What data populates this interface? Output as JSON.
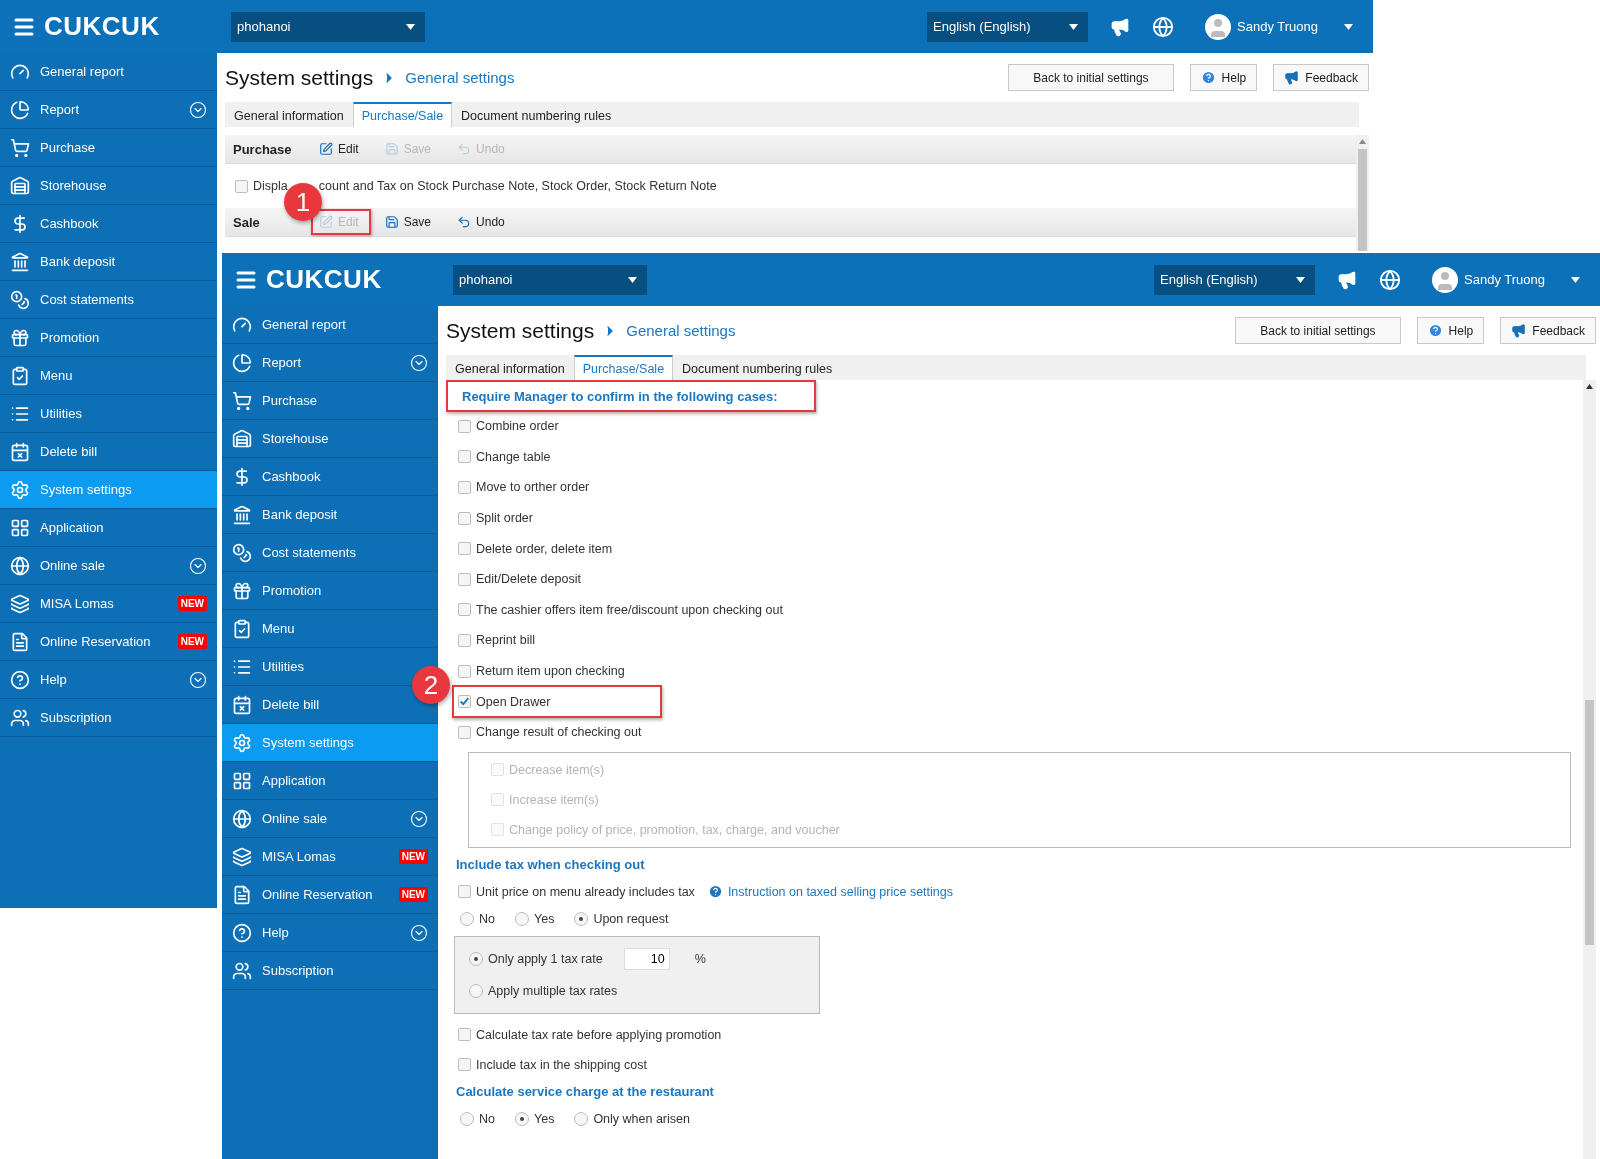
{
  "back_window": {
    "header": {
      "logo": "CUKCUK",
      "branch": "phohanoi",
      "language": "English (English)",
      "user": "Sandy Truong"
    },
    "sidebar": [
      {
        "label": "General report",
        "selected": false
      },
      {
        "label": "Report",
        "selected": false,
        "expandable": true
      },
      {
        "label": "Purchase",
        "selected": false
      },
      {
        "label": "Storehouse",
        "selected": false
      },
      {
        "label": "Cashbook",
        "selected": false
      },
      {
        "label": "Bank deposit",
        "selected": false
      },
      {
        "label": "Cost statements",
        "selected": false
      },
      {
        "label": "Promotion",
        "selected": false
      },
      {
        "label": "Menu",
        "selected": false
      },
      {
        "label": "Utilities",
        "selected": false
      },
      {
        "label": "Delete bill",
        "selected": false
      },
      {
        "label": "System settings",
        "selected": true
      },
      {
        "label": "Application",
        "selected": false
      },
      {
        "label": "Online sale",
        "selected": false,
        "expandable": true
      },
      {
        "label": "MISA Lomas",
        "selected": false,
        "badge": "NEW"
      },
      {
        "label": "Online Reservation",
        "selected": false,
        "badge": "NEW"
      },
      {
        "label": "Help",
        "selected": false,
        "expandable": true
      },
      {
        "label": "Subscription",
        "selected": false
      }
    ],
    "breadcrumb": {
      "title": "System settings",
      "current": "General settings"
    },
    "actions": [
      "Back to initial settings",
      "Help",
      "Feedback"
    ],
    "tabs": [
      {
        "label": "General information",
        "selected": false
      },
      {
        "label": "Purchase/Sale",
        "selected": true
      },
      {
        "label": "Document numbering rules",
        "selected": false
      }
    ],
    "purchase_bar": {
      "title": "Purchase",
      "buttons": [
        {
          "label": "Edit",
          "disabled": false,
          "highlighted": false
        },
        {
          "label": "Save",
          "disabled": true,
          "highlighted": false
        },
        {
          "label": "Undo",
          "disabled": true,
          "highlighted": false
        }
      ]
    },
    "display_option": {
      "checked": false,
      "text_before": "Displa",
      "text_after": "count and Tax on Stock Purchase Note, Stock Order, Stock Return Note"
    },
    "sale_bar": {
      "title": "Sale",
      "buttons": [
        {
          "label": "Edit",
          "disabled": true,
          "highlighted": true
        },
        {
          "label": "Save",
          "disabled": false,
          "highlighted": false
        },
        {
          "label": "Undo",
          "disabled": false,
          "highlighted": false
        }
      ]
    },
    "callout": "1"
  },
  "front_window": {
    "header": {
      "logo": "CUKCUK",
      "branch": "phohanoi",
      "language": "English (English)",
      "user": "Sandy Truong"
    },
    "sidebar": [
      {
        "label": "General report",
        "selected": false
      },
      {
        "label": "Report",
        "selected": false,
        "expandable": true
      },
      {
        "label": "Purchase",
        "selected": false
      },
      {
        "label": "Storehouse",
        "selected": false
      },
      {
        "label": "Cashbook",
        "selected": false
      },
      {
        "label": "Bank deposit",
        "selected": false
      },
      {
        "label": "Cost statements",
        "selected": false
      },
      {
        "label": "Promotion",
        "selected": false
      },
      {
        "label": "Menu",
        "selected": false
      },
      {
        "label": "Utilities",
        "selected": false
      },
      {
        "label": "Delete bill",
        "selected": false
      },
      {
        "label": "System settings",
        "selected": true
      },
      {
        "label": "Application",
        "selected": false
      },
      {
        "label": "Online sale",
        "selected": false,
        "expandable": true
      },
      {
        "label": "MISA Lomas",
        "selected": false,
        "badge": "NEW"
      },
      {
        "label": "Online Reservation",
        "selected": false,
        "badge": "NEW"
      },
      {
        "label": "Help",
        "selected": false,
        "expandable": true
      },
      {
        "label": "Subscription",
        "selected": false
      }
    ],
    "breadcrumb": {
      "title": "System settings",
      "current": "General settings"
    },
    "actions": [
      "Back to initial settings",
      "Help",
      "Feedback"
    ],
    "tabs": [
      {
        "label": "General information",
        "selected": false
      },
      {
        "label": "Purchase/Sale",
        "selected": true
      },
      {
        "label": "Document numbering rules",
        "selected": false
      }
    ],
    "require_section": {
      "heading": "Require Manager to confirm in the following cases:",
      "highlighted": true,
      "options": [
        {
          "label": "Combine order",
          "checked": false,
          "highlighted": false
        },
        {
          "label": "Change table",
          "checked": false,
          "highlighted": false
        },
        {
          "label": "Move to orther order",
          "checked": false,
          "highlighted": false
        },
        {
          "label": "Split order",
          "checked": false,
          "highlighted": false
        },
        {
          "label": "Delete order, delete item",
          "checked": false,
          "highlighted": false
        },
        {
          "label": "Edit/Delete deposit",
          "checked": false,
          "highlighted": false
        },
        {
          "label": "The cashier offers item free/discount upon checking out",
          "checked": false,
          "highlighted": false
        },
        {
          "label": "Reprint bill",
          "checked": false,
          "highlighted": false
        },
        {
          "label": "Return item upon checking",
          "checked": false,
          "highlighted": false
        },
        {
          "label": "Open Drawer",
          "checked": true,
          "highlighted": true
        },
        {
          "label": "Change result of checking out",
          "checked": false,
          "highlighted": false
        }
      ],
      "sub_options": [
        {
          "label": "Decrease item(s)",
          "checked": false,
          "disabled": true
        },
        {
          "label": "Increase item(s)",
          "checked": false,
          "disabled": true
        },
        {
          "label": "Change policy of price, promotion, tax, charge, and voucher",
          "checked": false,
          "disabled": true
        }
      ]
    },
    "tax_section": {
      "heading": "Include tax when checking out",
      "unit_price": {
        "label": "Unit price on menu already includes tax",
        "checked": false,
        "link": "Instruction on taxed selling price settings"
      },
      "modes": [
        {
          "label": "No",
          "selected": false
        },
        {
          "label": "Yes",
          "selected": false
        },
        {
          "label": "Upon request",
          "selected": true
        }
      ],
      "rates": [
        {
          "label": "Only apply 1 tax rate",
          "selected": true
        },
        {
          "label": "Apply multiple tax rates",
          "selected": false
        }
      ],
      "rate_value": "10",
      "rate_unit": "%",
      "options": [
        {
          "label": "Calculate tax rate before applying promotion",
          "checked": false
        },
        {
          "label": "Include tax in the shipping cost",
          "checked": false
        }
      ]
    },
    "service_section": {
      "heading": "Calculate service charge at the restaurant",
      "modes": [
        {
          "label": "No",
          "selected": false
        },
        {
          "label": "Yes",
          "selected": true
        },
        {
          "label": "Only when arisen",
          "selected": false
        }
      ]
    },
    "callout": "2"
  }
}
